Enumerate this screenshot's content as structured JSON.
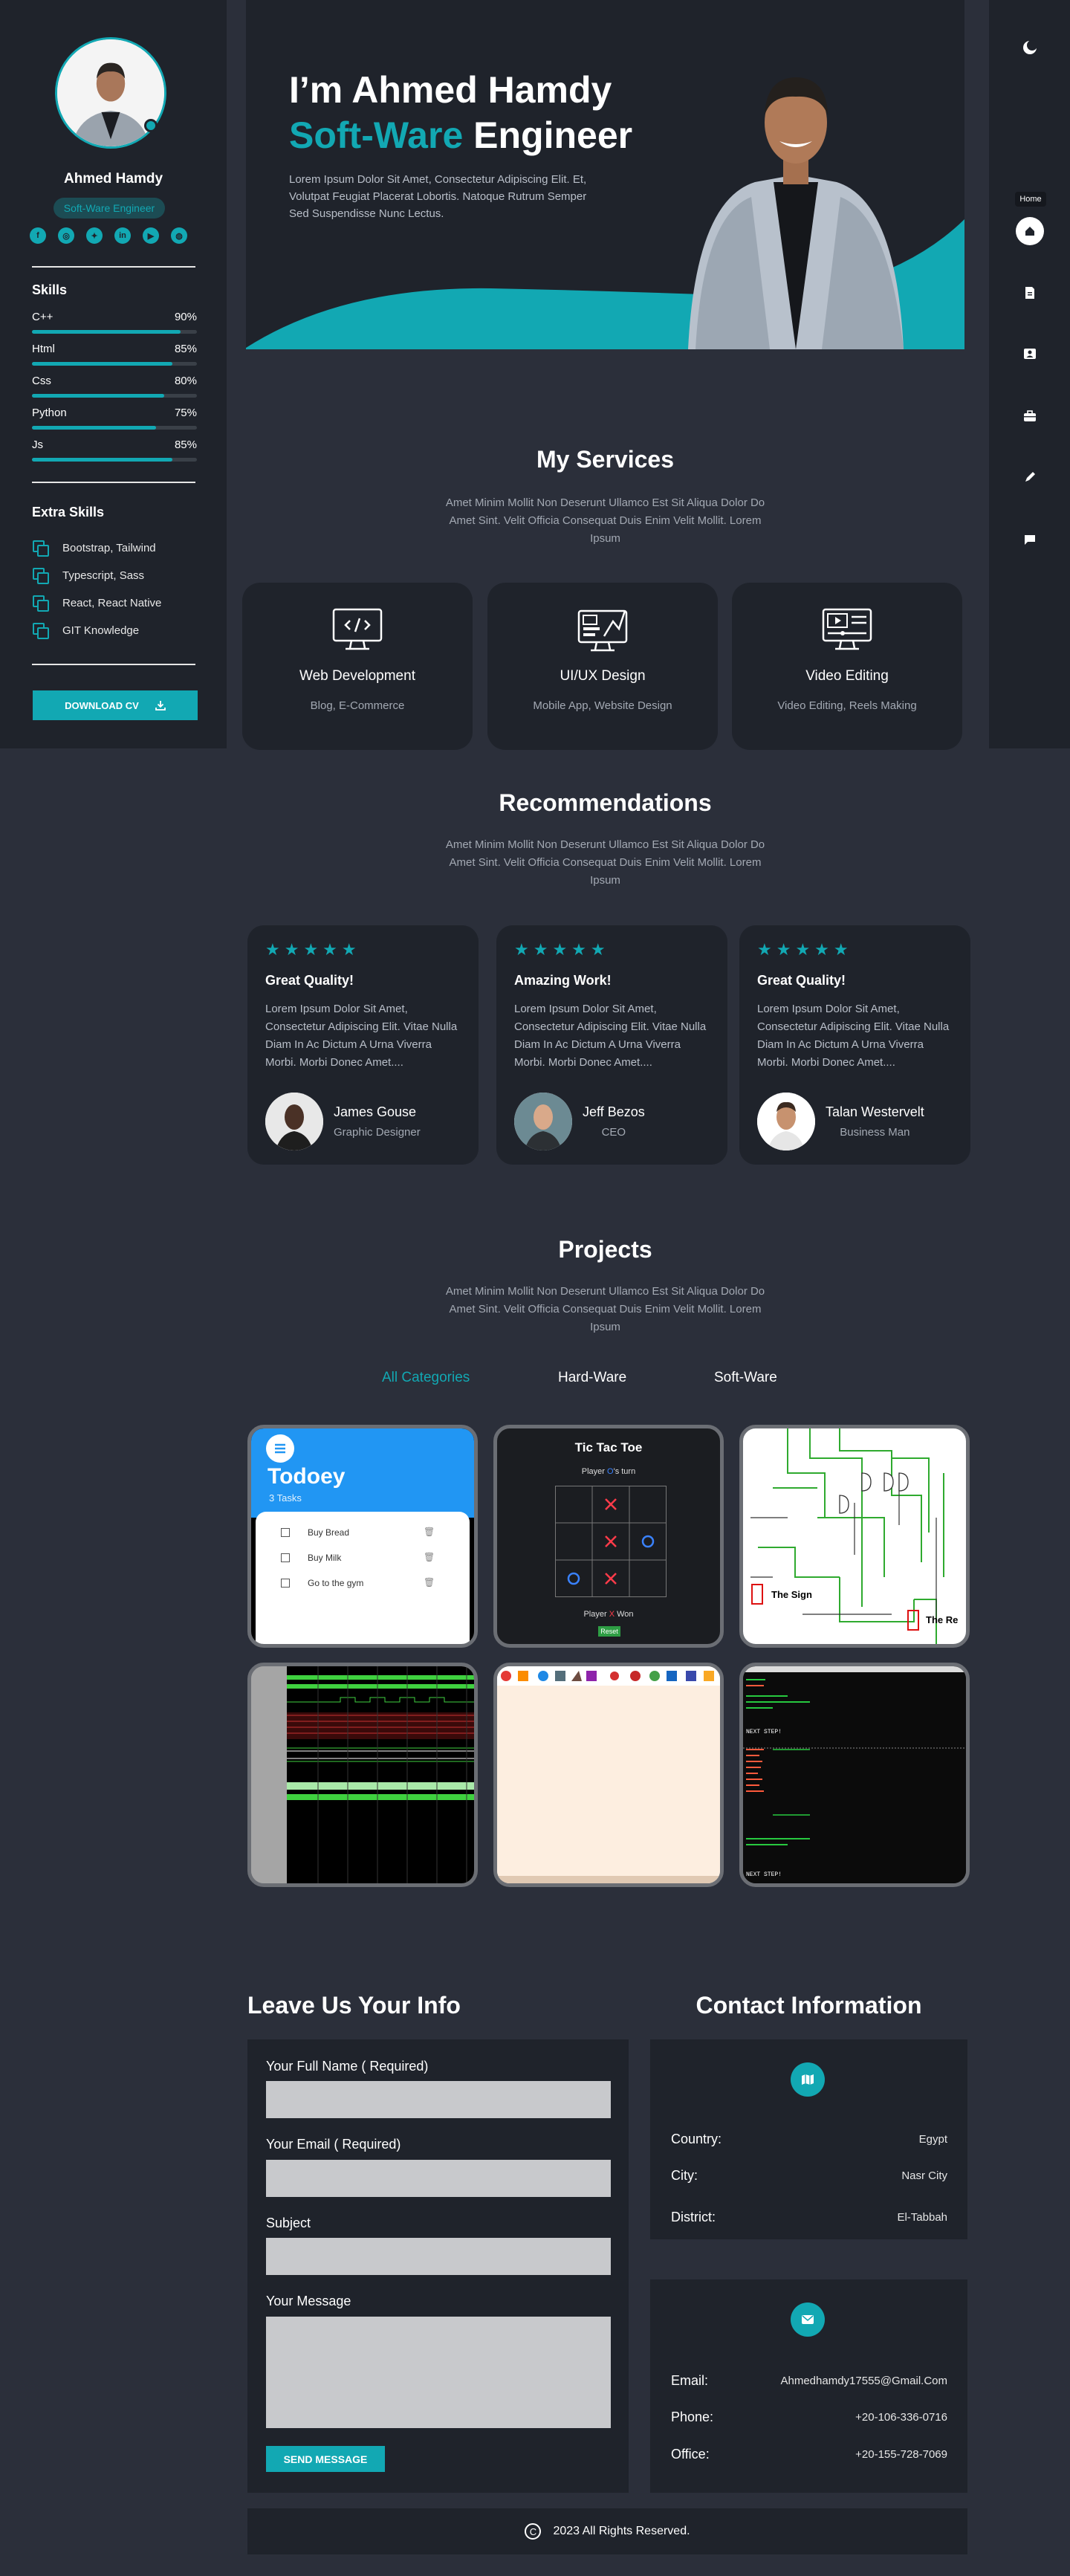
{
  "sidebar": {
    "name": "Ahmed Hamdy",
    "role": "Soft-Ware Engineer",
    "socials": [
      {
        "icon": "facebook-icon",
        "glyph": "f"
      },
      {
        "icon": "instagram-icon",
        "glyph": "◎"
      },
      {
        "icon": "twitter-icon",
        "glyph": "✦"
      },
      {
        "icon": "linkedin-icon",
        "glyph": "in"
      },
      {
        "icon": "youtube-icon",
        "glyph": "▶"
      },
      {
        "icon": "dribbble-icon",
        "glyph": "◍"
      }
    ],
    "skills_heading": "Skills",
    "skills": [
      {
        "name": "C++",
        "level": "90%"
      },
      {
        "name": "Html",
        "level": "85%"
      },
      {
        "name": "Css",
        "level": "80%"
      },
      {
        "name": "Python",
        "level": "75%"
      },
      {
        "name": "Js",
        "level": "85%"
      }
    ],
    "extra_heading": "Extra Skills",
    "extra_skills": [
      "Bootstrap, Tailwind",
      "Typescript, Sass",
      "React, React Native",
      "GIT Knowledge"
    ],
    "download_label": "DOWNLOAD CV"
  },
  "nav": {
    "home_label": "Home",
    "items": [
      "moon-icon",
      "home-icon",
      "resume-icon",
      "contact-card-icon",
      "briefcase-icon",
      "pen-icon",
      "chat-icon"
    ]
  },
  "hero": {
    "line1": "I’m Ahmed Hamdy",
    "accent": "Soft-Ware",
    "line2_rest": " Engineer",
    "description": "Lorem Ipsum Dolor Sit Amet, Consectetur Adipiscing Elit. Et, Volutpat Feugiat Placerat Lobortis. Natoque Rutrum Semper Sed Suspendisse Nunc Lectus."
  },
  "services": {
    "title": "My Services",
    "description": "Amet Minim Mollit Non Deserunt Ullamco Est Sit Aliqua Dolor Do Amet Sint. Velit Officia Consequat Duis Enim Velit Mollit. Lorem Ipsum",
    "items": [
      {
        "title": "Web Development",
        "sub": "Blog, E-Commerce",
        "icon": "code-monitor-icon"
      },
      {
        "title": "UI/UX Design",
        "sub": "Mobile App, Website Design",
        "icon": "design-monitor-icon"
      },
      {
        "title": "Video Editing",
        "sub": "Video Editing, Reels Making",
        "icon": "video-monitor-icon"
      }
    ]
  },
  "recommendations": {
    "title": "Recommendations",
    "description": "Amet Minim Mollit Non Deserunt Ullamco Est Sit Aliqua Dolor Do Amet Sint. Velit Officia Consequat Duis Enim Velit Mollit. Lorem Ipsum",
    "stars": "★★★★★",
    "items": [
      {
        "title": "Great Quality!",
        "text": "Lorem Ipsum Dolor Sit Amet, Consectetur Adipiscing Elit. Vitae Nulla Diam In Ac Dictum A Urna Viverra Morbi. Morbi Donec Amet....",
        "name": "James Gouse",
        "position": "Graphic Designer"
      },
      {
        "title": "Amazing Work!",
        "text": "Lorem Ipsum Dolor Sit Amet, Consectetur Adipiscing Elit. Vitae Nulla Diam In Ac Dictum A Urna Viverra Morbi. Morbi Donec Amet....",
        "name": "Jeff Bezos",
        "position": "CEO"
      },
      {
        "title": "Great Quality!",
        "text": "Lorem Ipsum Dolor Sit Amet, Consectetur Adipiscing Elit. Vitae Nulla Diam In Ac Dictum A Urna Viverra Morbi. Morbi Donec Amet....",
        "name": "Talan Westervelt",
        "position": "Business Man"
      }
    ]
  },
  "projects": {
    "title": "Projects",
    "description": "Amet Minim Mollit Non Deserunt Ullamco Est Sit Aliqua Dolor Do Amet Sint. Velit Officia Consequat Duis Enim Velit Mollit. Lorem Ipsum",
    "filters": [
      "All Categories",
      "Hard-Ware",
      "Soft-Ware"
    ],
    "todoey": {
      "title": "Todoey",
      "count": "3 Tasks",
      "tasks": [
        "Buy Bread",
        "Buy Milk",
        "Go to the gym"
      ]
    },
    "tictactoe": {
      "title": "Tic Tac Toe",
      "status_pre": "Player ",
      "status_mark": "O",
      "status_post": "'s turn",
      "win_pre": "Player ",
      "win_mark": "X",
      "win_post": " Won",
      "reset": "Reset"
    },
    "circuit": {
      "label1": "The Sign",
      "label2": "The Re"
    },
    "terminal": {
      "line": "NEXT STEP!"
    }
  },
  "contact": {
    "form_title": "Leave Us Your Info",
    "full_name_label": "Your Full Name ( Required)",
    "email_label": "Your Email ( Required)",
    "subject_label": "Subject",
    "message_label": "Your Message",
    "send_label": "SEND MESSAGE",
    "info_title": "Contact Information",
    "address": [
      {
        "key": "Country:",
        "value": "Egypt"
      },
      {
        "key": "City:",
        "value": "Nasr City"
      },
      {
        "key": "District:",
        "value": "El-Tabbah"
      }
    ],
    "reach": [
      {
        "key": "Email:",
        "value": "Ahmedhamdy17555@Gmail.Com"
      },
      {
        "key": "Phone:",
        "value": "+20-106-336-0716"
      },
      {
        "key": "Office:",
        "value": "+20-155-728-7069"
      }
    ]
  },
  "footer": {
    "copyright_glyph": "C",
    "text": "2023 All Rights Reserved."
  },
  "colors": {
    "accent": "#12A8B3",
    "panel": "#1F232B",
    "background": "#2B2F3A"
  }
}
